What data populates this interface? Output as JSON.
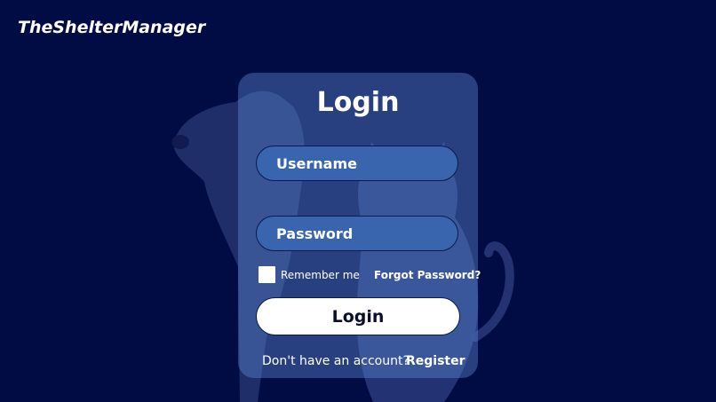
{
  "brand": {
    "name": "TheShelterManager"
  },
  "login": {
    "title": "Login",
    "username_placeholder": "Username",
    "password_placeholder": "Password",
    "remember_label": "Remember me",
    "forgot_label": "Forgot Password?",
    "submit_label": "Login",
    "no_account_text": "Don't have an account?",
    "register_label": "Register"
  },
  "colors": {
    "background": "#020c44",
    "card": "#5c8ad4",
    "input": "#3865ae",
    "button": "#ffffff"
  }
}
